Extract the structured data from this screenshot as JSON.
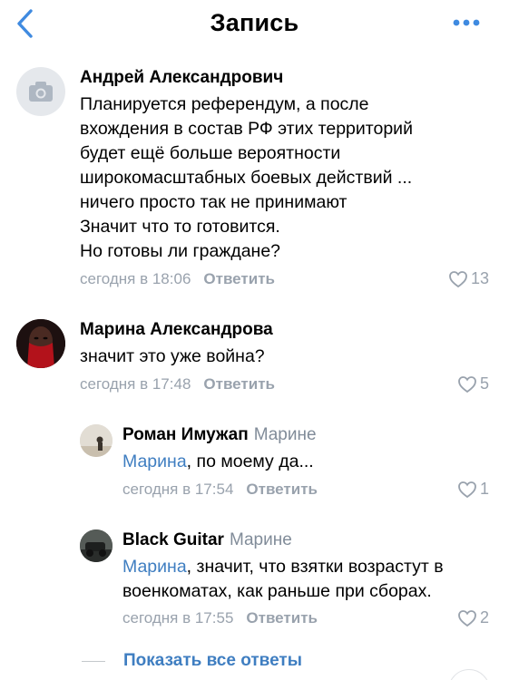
{
  "nav": {
    "title": "Запись",
    "back_icon": "chevron-left-icon",
    "more_icon": "more-horizontal-icon",
    "accent": "#3f8ae0"
  },
  "comments": [
    {
      "author": "Андрей Александрович",
      "text_lines": [
        "Планируется референдум, а после",
        "вхождения в состав РФ этих территорий",
        "будет ещё больше вероятности",
        "широкомасштабных боевых действий ...",
        "ничего просто так не принимают",
        "Значит что то готовится.",
        "Но готовы ли граждане?"
      ],
      "time": "сегодня в 18:06",
      "reply_label": "Ответить",
      "likes": "13",
      "avatar_icon": "camera-icon"
    },
    {
      "author": "Марина Александрова",
      "text_lines": [
        "значит это уже война?"
      ],
      "time": "сегодня в 17:48",
      "reply_label": "Ответить",
      "likes": "5"
    }
  ],
  "replies": [
    {
      "author": "Роман Имужап",
      "reply_to": "Марине",
      "mention": "Марина",
      "text_line1": ", по моему да...",
      "time": "сегодня в 17:54",
      "reply_label": "Ответить",
      "likes": "1"
    },
    {
      "author": "Black Guitar",
      "reply_to": "Марине",
      "mention": "Марина",
      "text_line1": ", значит, что взятки возрастут в",
      "text_line2": "военкоматах, как раньше при сборах.",
      "time": "сегодня в 17:55",
      "reply_label": "Ответить",
      "likes": "2"
    }
  ],
  "show_all_replies": "Показать все ответы",
  "colors": {
    "secondary_text": "#99a2ad",
    "link": "#3f7ec1"
  }
}
